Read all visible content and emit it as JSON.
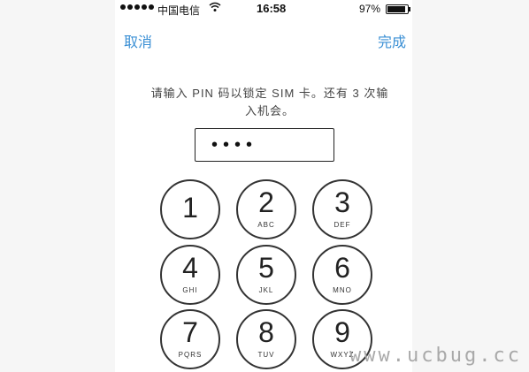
{
  "status_bar": {
    "carrier": "中国电信",
    "wifi_icon": "wifi-icon",
    "time": "16:58",
    "battery_percent": "97%",
    "battery_level": 0.97
  },
  "nav": {
    "cancel_label": "取消",
    "done_label": "完成"
  },
  "prompt": {
    "line1": "请输入 PIN 码以锁定 SIM 卡。还有 3 次输",
    "line2": "入机会。"
  },
  "pin_field": {
    "masked_value": "••••"
  },
  "keypad": {
    "keys": [
      {
        "digit": "1",
        "letters": ""
      },
      {
        "digit": "2",
        "letters": "ABC"
      },
      {
        "digit": "3",
        "letters": "DEF"
      },
      {
        "digit": "4",
        "letters": "GHI"
      },
      {
        "digit": "5",
        "letters": "JKL"
      },
      {
        "digit": "6",
        "letters": "MNO"
      },
      {
        "digit": "7",
        "letters": "PQRS"
      },
      {
        "digit": "8",
        "letters": "TUV"
      },
      {
        "digit": "9",
        "letters": "WXYZ"
      }
    ]
  },
  "watermark": "www.ucbug.cc",
  "colors": {
    "accent": "#3a8fd4"
  }
}
